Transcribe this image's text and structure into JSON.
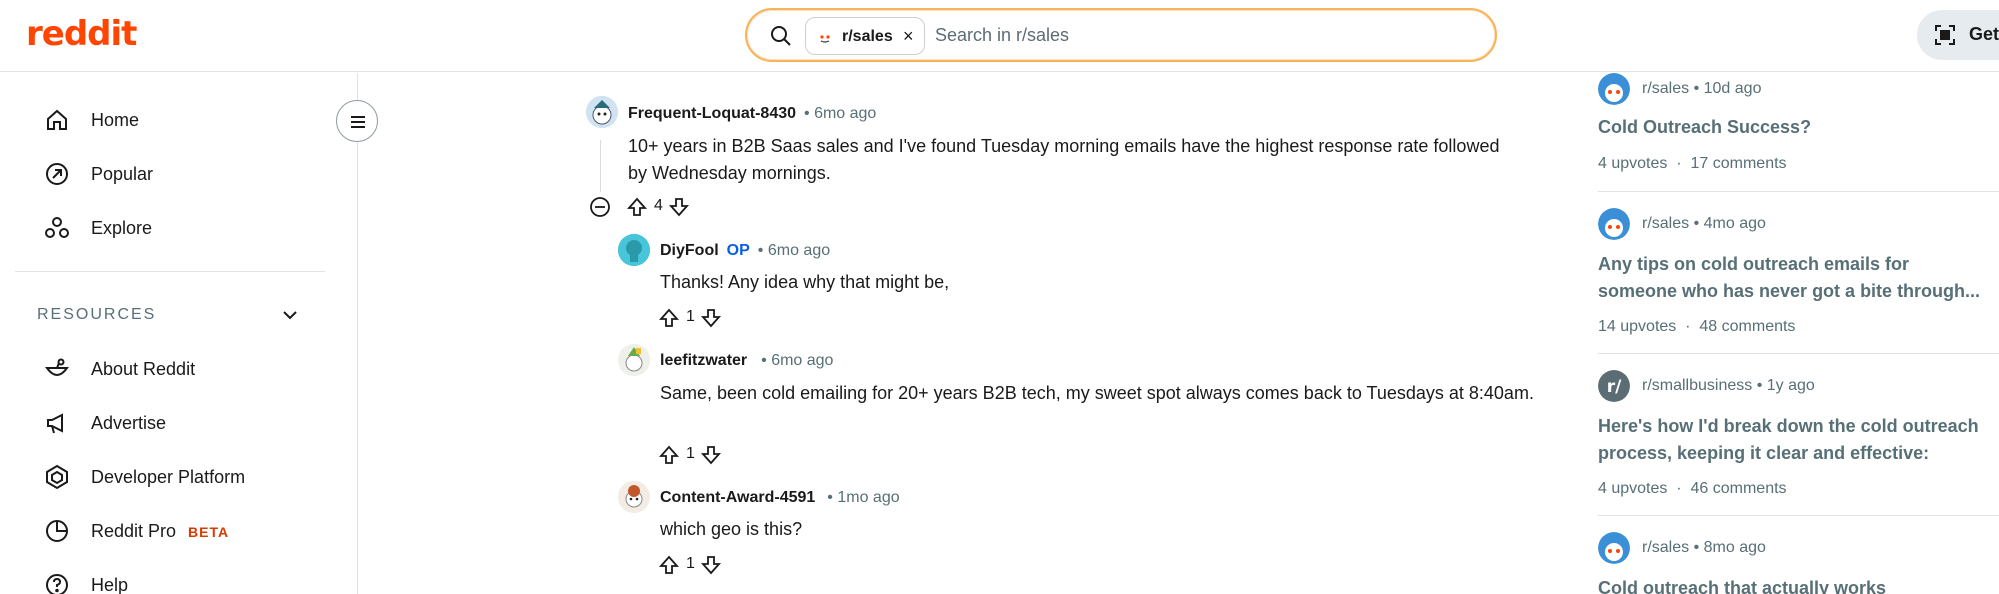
{
  "header": {
    "logo": "reddit",
    "search_chip": "r/sales",
    "search_chip_close": "×",
    "search_placeholder": "Search in r/sales",
    "get_app": "Get"
  },
  "sidebar": {
    "items": [
      {
        "label": "Home",
        "icon": "home-icon"
      },
      {
        "label": "Popular",
        "icon": "popular-icon"
      },
      {
        "label": "Explore",
        "icon": "explore-icon"
      }
    ],
    "resources_heading": "RESOURCES",
    "resources": [
      {
        "label": "About Reddit",
        "icon": "about-icon"
      },
      {
        "label": "Advertise",
        "icon": "megaphone-icon"
      },
      {
        "label": "Developer Platform",
        "icon": "developer-icon"
      },
      {
        "label": "Reddit Pro",
        "badge": "BETA",
        "icon": "pro-icon"
      },
      {
        "label": "Help",
        "icon": "help-icon"
      }
    ]
  },
  "comments": [
    {
      "author": "Frequent-Loquat-8430",
      "time": "6mo ago",
      "body": "10+ years in B2B Saas sales and I've found Tuesday morning emails have the highest response rate followed by Wednesday mornings.",
      "votes": "4"
    },
    {
      "author": "DiyFool",
      "op": "OP",
      "time": "6mo ago",
      "body": "Thanks! Any idea why that might be,",
      "votes": "1"
    },
    {
      "author": "leefitzwater",
      "time": "6mo ago",
      "body": "Same, been cold emailing for 20+ years B2B tech, my sweet spot always comes back to Tuesdays at 8:40am.",
      "votes": "1"
    },
    {
      "author": "Content-Award-4591",
      "time": "1mo ago",
      "body": "which geo is this?",
      "votes": "1"
    }
  ],
  "related": [
    {
      "sub": "r/sales",
      "time": "10d ago",
      "title_lines": [
        "Cold Outreach Success?"
      ],
      "upvotes": "4 upvotes",
      "comments": "17 comments"
    },
    {
      "sub": "r/sales",
      "time": "4mo ago",
      "title_lines": [
        "Any tips on cold outreach emails for",
        "someone who has never got a bite through..."
      ],
      "upvotes": "14 upvotes",
      "comments": "48 comments"
    },
    {
      "sub": "r/smallbusiness",
      "time": "1y ago",
      "title_lines": [
        "Here's how I'd break down the cold outreach",
        "process, keeping it clear and effective:"
      ],
      "upvotes": "4 upvotes",
      "comments": "46 comments"
    },
    {
      "sub": "r/sales",
      "time": "8mo ago",
      "title_lines": [
        "Cold outreach that actually works"
      ],
      "upvotes": "",
      "comments": ""
    }
  ],
  "colors": {
    "brand": "#ff4500",
    "op": "#0a5fe0",
    "beta": "#d93a00"
  }
}
